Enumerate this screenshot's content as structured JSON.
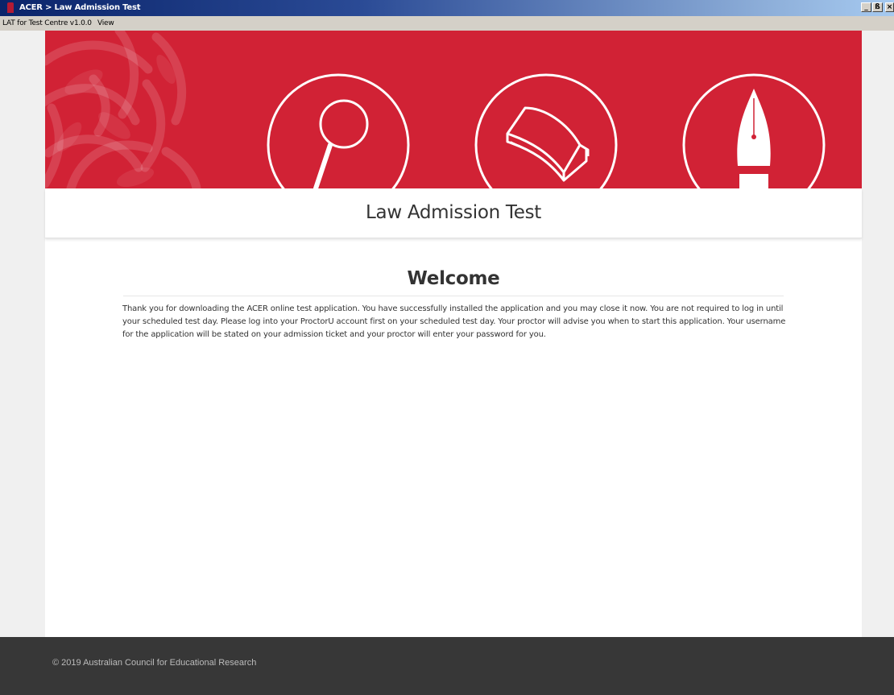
{
  "window": {
    "title": "ACER > Law Admission Test",
    "controls": {
      "minimize": "_",
      "restore": "ß",
      "close": "×"
    }
  },
  "menubar": {
    "items": [
      {
        "label": "LAT for Test Centre v1.0.0"
      },
      {
        "label": "View"
      }
    ]
  },
  "banner": {
    "title": "Law Admission Test",
    "icons": [
      "magnifying-glass-icon",
      "book-icon",
      "fountain-pen-icon"
    ],
    "background_color": "#d12235"
  },
  "welcome": {
    "heading": "Welcome",
    "body": "Thank you for downloading the ACER online test application. You have successfully installed the application and you may close it now. You are not required to log in until your scheduled test day. Please log into your ProctorU account first on your scheduled test day. Your proctor will advise you when to start this application. Your username for the application will be stated on your admission ticket and your proctor will enter your password for you."
  },
  "footer": {
    "copyright": "© 2019 Australian Council for Educational Research",
    "background_color": "#373737"
  }
}
